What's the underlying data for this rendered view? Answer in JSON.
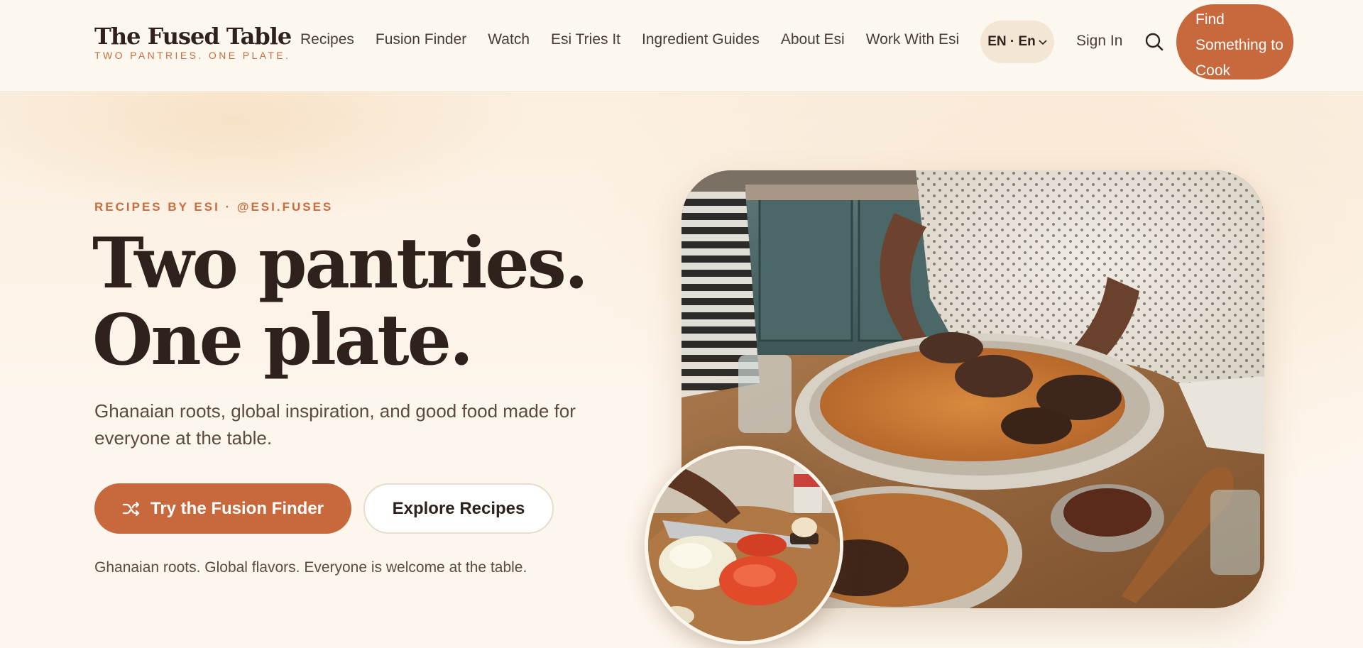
{
  "header": {
    "brand_title": "The Fused Table",
    "brand_tagline": "TWO PANTRIES. ONE PLATE.",
    "nav": [
      {
        "label": "Recipes"
      },
      {
        "label": "Fusion Finder"
      },
      {
        "label": "Watch"
      },
      {
        "label": "Esi Tries It"
      },
      {
        "label": "Ingredient Guides"
      },
      {
        "label": "About Esi"
      },
      {
        "label": "Work With Esi"
      }
    ],
    "language_label": "EN · En",
    "sign_in_label": "Sign In",
    "search_icon": "search-icon",
    "cta_label": "Find Something to Cook"
  },
  "hero": {
    "eyebrow": "RECIPES BY ESI · @ESI.FUSES",
    "headline_line1": "Two pantries.",
    "headline_line2": "One plate.",
    "subtitle": "Ghanaian roots, global inspiration, and good food made for everyone at the table.",
    "primary_button": "Try the Fusion Finder",
    "primary_button_icon": "shuffle-icon",
    "secondary_button": "Explore Recipes",
    "tagline": "Ghanaian roots. Global flavors. Everyone is welcome at the table."
  },
  "colors": {
    "accent": "#c8693d",
    "background": "#fdf6ec",
    "text_dark": "#2f221c",
    "header_bg": "#fdf8ef"
  }
}
